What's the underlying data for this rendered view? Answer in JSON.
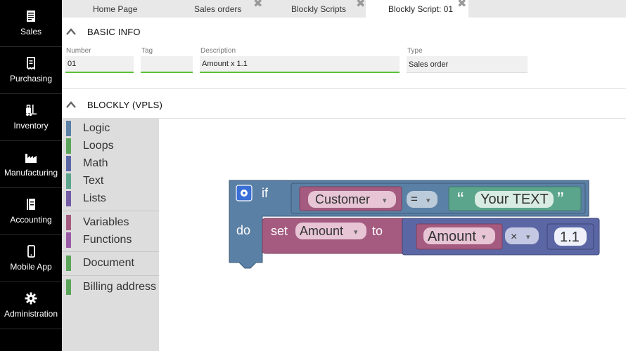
{
  "sidebar": {
    "items": [
      {
        "label": "Sales",
        "icon": "document-icon"
      },
      {
        "label": "Purchasing",
        "icon": "receipt-icon"
      },
      {
        "label": "Inventory",
        "icon": "forklift-icon"
      },
      {
        "label": "Manufacturing",
        "icon": "factory-icon"
      },
      {
        "label": "Accounting",
        "icon": "ledger-icon"
      },
      {
        "label": "Mobile App",
        "icon": "phone-icon"
      },
      {
        "label": "Administration",
        "icon": "gear-icon"
      }
    ]
  },
  "tabs": [
    {
      "label": "Home Page",
      "closable": false,
      "active": false
    },
    {
      "label": "Sales orders",
      "closable": true,
      "active": false
    },
    {
      "label": "Blockly Scripts",
      "closable": true,
      "active": false
    },
    {
      "label": "Blockly Script: 01",
      "closable": true,
      "active": true
    }
  ],
  "tab_close_glyph": "✖",
  "basic_info": {
    "title": "BASIC INFO",
    "fields": {
      "number": {
        "label": "Number",
        "value": "01"
      },
      "tag": {
        "label": "Tag",
        "value": ""
      },
      "description": {
        "label": "Description",
        "value": "Amount x 1.1"
      },
      "type": {
        "label": "Type",
        "value": "Sales order"
      }
    }
  },
  "blockly": {
    "title": "BLOCKLY (VPLS)",
    "toolbox": [
      {
        "label": "Logic",
        "color": "#5b80a5"
      },
      {
        "label": "Loops",
        "color": "#5ba55b"
      },
      {
        "label": "Math",
        "color": "#5b67a5"
      },
      {
        "label": "Text",
        "color": "#5ba58c"
      },
      {
        "label": "Lists",
        "color": "#745ba5"
      },
      {
        "label": "Variables",
        "color": "#a55b80"
      },
      {
        "label": "Functions",
        "color": "#995ba5"
      },
      {
        "label": "Document",
        "color": "#5ba55b"
      },
      {
        "label": "Billing address",
        "color": "#5ba55b"
      }
    ],
    "blocks": {
      "if_keyword": "if",
      "do_keyword": "do",
      "compare_variable": "Customer",
      "compare_operator": "=",
      "text_open_quote": "“",
      "text_value": "Your TEXT",
      "text_close_quote": "”",
      "set_keyword": "set",
      "set_variable": "Amount",
      "to_keyword": "to",
      "math_variable": "Amount",
      "math_operator": "×",
      "math_number": "1.1",
      "dropdown_arrow": "▾",
      "colors": {
        "logic": "#5b80a5",
        "variables": "#a55b80",
        "text": "#5ba58c",
        "math": "#5b67a5"
      }
    }
  }
}
